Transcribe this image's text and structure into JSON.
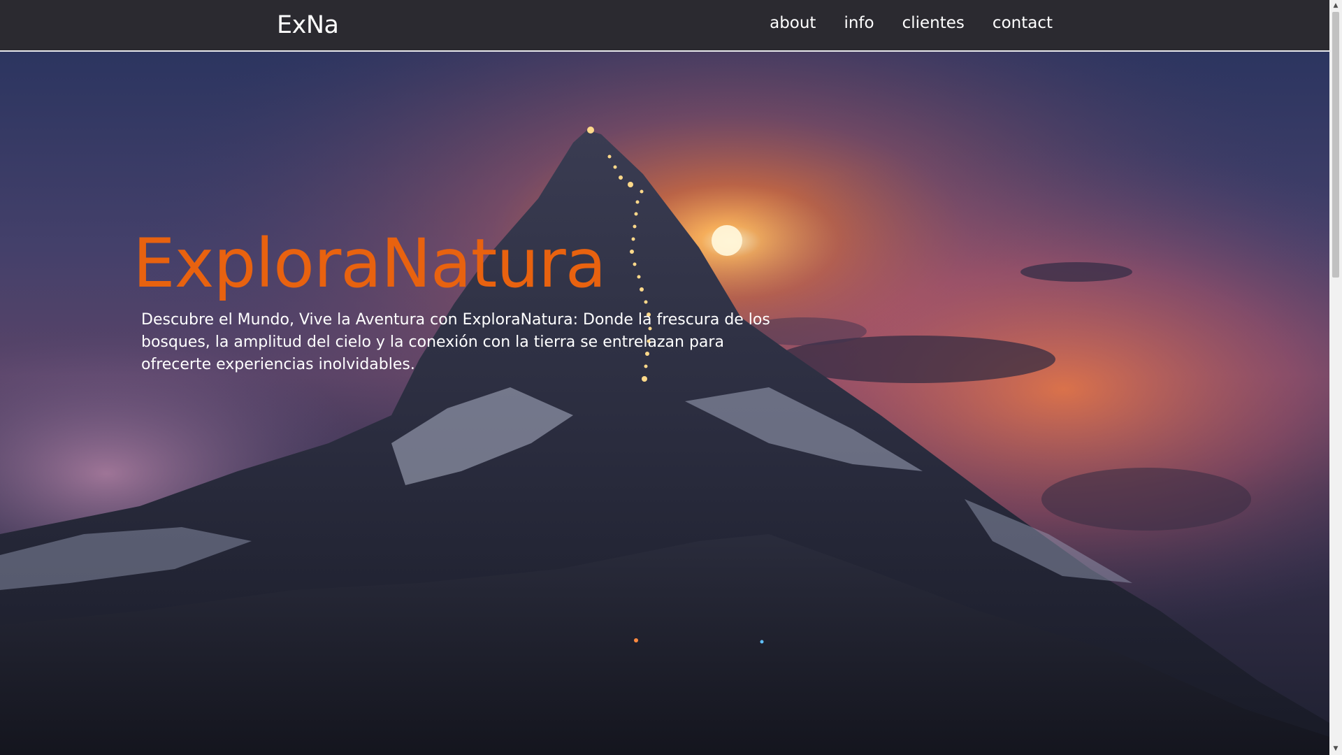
{
  "nav": {
    "brand": "ExNa",
    "links": [
      "about",
      "info",
      "clientes",
      "contact"
    ]
  },
  "hero": {
    "title": "ExploraNatura",
    "description": "Descubre el Mundo, Vive la Aventura con ExploraNatura: Donde la frescura de los bosques, la amplitud del cielo y la conexión con la tierra se entrelazan para ofrecerte experiencias inolvidables.",
    "background_image": "mountain-peak-at-dusk-with-lit-trail"
  },
  "colors": {
    "navbar_bg": "#2b2a30",
    "title_orange": "#e8620f",
    "text_white": "#ffffff"
  },
  "scrollbar": {
    "up_icon": "arrow-up-icon",
    "down_icon": "arrow-down-icon"
  }
}
